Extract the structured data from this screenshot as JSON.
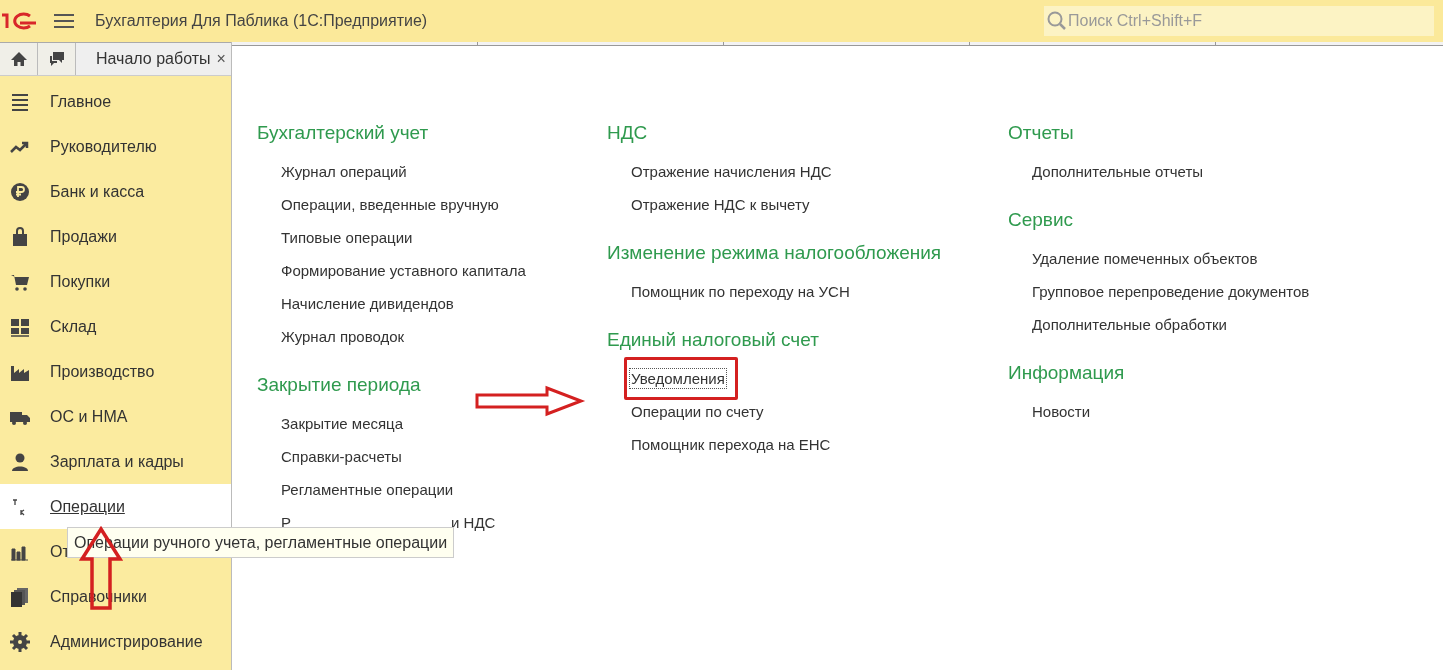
{
  "header": {
    "title": "Бухгалтерия Для Паблика  (1С:Предприятие)",
    "search": {
      "placeholder": "Поиск Ctrl+Shift+F"
    }
  },
  "tabs": [
    {
      "label": "Начало работы",
      "close": "×",
      "selected": true
    }
  ],
  "sidebar": {
    "items": [
      {
        "label": "Главное",
        "selected": false
      },
      {
        "label": "Руководителю",
        "selected": false
      },
      {
        "label": "Банк и касса",
        "selected": false
      },
      {
        "label": "Продажи",
        "selected": false
      },
      {
        "label": "Покупки",
        "selected": false
      },
      {
        "label": "Склад",
        "selected": false
      },
      {
        "label": "Производство",
        "selected": false
      },
      {
        "label": "ОС и НМА",
        "selected": false
      },
      {
        "label": "Зарплата и кадры",
        "selected": false
      },
      {
        "label": "Операции",
        "selected": true
      },
      {
        "label": "От",
        "selected": false
      },
      {
        "label": "Справочники",
        "selected": false
      },
      {
        "label": "Администрирование",
        "selected": false
      }
    ]
  },
  "columns": [
    [
      {
        "title": "Бухгалтерский учет",
        "items": [
          {
            "label": "Журнал операций",
            "highlighted": false
          },
          {
            "label": "Операции, введенные вручную",
            "highlighted": false
          },
          {
            "label": "Типовые операции",
            "highlighted": false
          },
          {
            "label": "Формирование уставного капитала",
            "highlighted": false
          },
          {
            "label": "Начисление дивидендов",
            "highlighted": false
          },
          {
            "label": "Журнал проводок",
            "highlighted": false
          }
        ]
      },
      {
        "title": "Закрытие периода",
        "items": [
          {
            "label": "Закрытие месяца",
            "highlighted": false
          },
          {
            "label": "Справки-расчеты",
            "highlighted": false
          },
          {
            "label": "Регламентные операции",
            "highlighted": false
          },
          {
            "label": "Р",
            "label_end": "и НДС",
            "highlighted": false
          }
        ]
      }
    ],
    [
      {
        "title": "НДС",
        "items": [
          {
            "label": "Отражение начисления НДС",
            "highlighted": false
          },
          {
            "label": "Отражение НДС к вычету",
            "highlighted": false
          }
        ]
      },
      {
        "title": "Изменение режима налогообложения",
        "items": [
          {
            "label": "Помощник по переходу на УСН",
            "highlighted": false
          }
        ]
      },
      {
        "title": "Единый налоговый счет",
        "items": [
          {
            "label": "Уведомления",
            "highlighted": true
          },
          {
            "label": "Операции по счету",
            "highlighted": false
          },
          {
            "label": "Помощник перехода на ЕНС",
            "highlighted": false
          }
        ]
      }
    ],
    [
      {
        "title": "Отчеты",
        "items": [
          {
            "label": "Дополнительные отчеты",
            "highlighted": false
          }
        ]
      },
      {
        "title": "Сервис",
        "items": [
          {
            "label": "Удаление помеченных объектов",
            "highlighted": false
          },
          {
            "label": "Групповое перепроведение документов",
            "highlighted": false
          },
          {
            "label": "Дополнительные обработки",
            "highlighted": false
          }
        ]
      },
      {
        "title": "Информация",
        "items": [
          {
            "label": "Новости",
            "highlighted": false
          }
        ]
      }
    ]
  ],
  "tooltip": {
    "text": "Операции ручного учета, регламентные операции"
  }
}
